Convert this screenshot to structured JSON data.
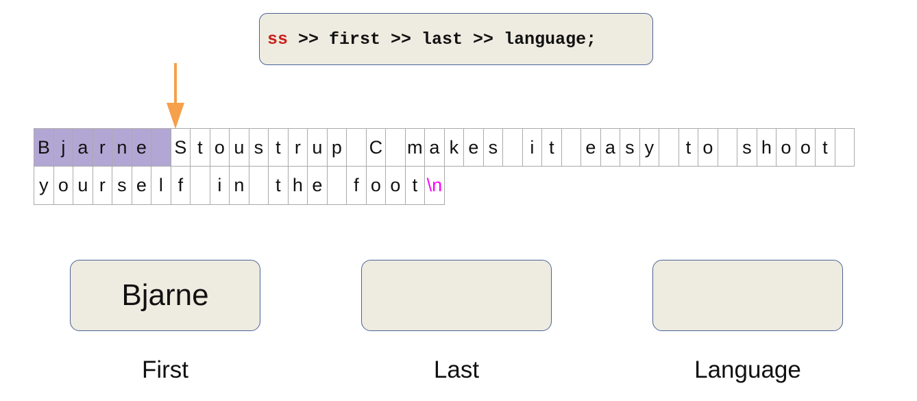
{
  "code": {
    "stream": "ss",
    "rest": " >> first >> last >> language;"
  },
  "colors": {
    "stream": "#c8201a",
    "highlight": "#b2a7d4",
    "arrow": "#f5a04a",
    "escape": "#ff00ff",
    "box_fill": "#eeebe0",
    "box_border": "#4a6296"
  },
  "buffer": {
    "row1": [
      "B",
      "j",
      "a",
      "r",
      "n",
      "e",
      " ",
      "S",
      "t",
      "o",
      "u",
      "s",
      "t",
      "r",
      "u",
      "p",
      " ",
      "C",
      " ",
      "m",
      "a",
      "k",
      "e",
      "s",
      " ",
      "i",
      "t",
      " ",
      "e",
      "a",
      "s",
      "y",
      " ",
      "t",
      "o",
      " ",
      "s",
      "h",
      "o",
      "o",
      "t",
      " "
    ],
    "row2": [
      "y",
      "o",
      "u",
      "r",
      "s",
      "e",
      "l",
      "f",
      " ",
      "i",
      "n",
      " ",
      "t",
      "h",
      "e",
      " ",
      "f",
      "o",
      "o",
      "t",
      "\\n"
    ],
    "consumed_count": 7,
    "escape_chars": [
      "\\n"
    ]
  },
  "variables": [
    {
      "label": "First",
      "value": "Bjarne"
    },
    {
      "label": "Last",
      "value": ""
    },
    {
      "label": "Language",
      "value": ""
    }
  ]
}
